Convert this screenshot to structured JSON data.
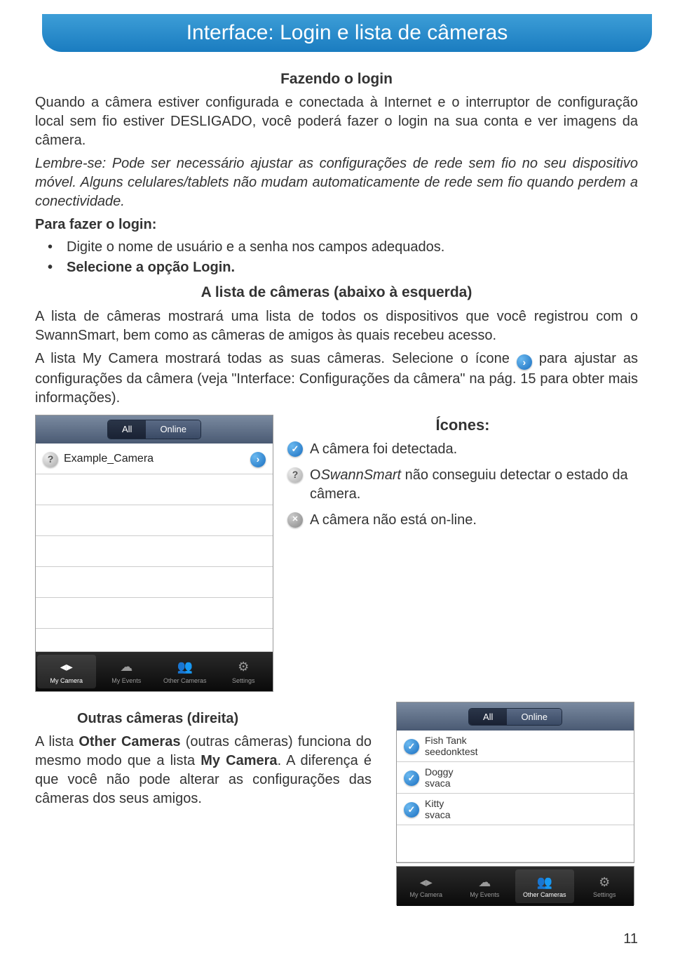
{
  "title_bar": "Interface: Login e lista de câmeras",
  "s1": {
    "heading": "Fazendo o login",
    "p1a": "Quando a câmera estiver configurada e conectada à Internet e o interruptor de configuração local sem fio estiver ",
    "p1b": "DESLIGADO",
    "p1c": ", você poderá fazer o login na sua conta e ver imagens da câmera.",
    "p2": "Lembre-se: Pode ser necessário ajustar as configurações de rede sem fio no seu dispositivo móvel. Alguns celulares/tablets não mudam automaticamente de rede sem fio quando perdem a conectividade.",
    "p3": "Para fazer o login:",
    "li1": "Digite o nome de usuário e a senha nos campos adequados.",
    "li2": "Selecione a opção Login."
  },
  "s2": {
    "heading": "A lista de câmeras (abaixo à esquerda)",
    "p1": "A lista de câmeras mostrará uma lista de todos os dispositivos que você registrou com o SwannSmart, bem como as câmeras de amigos às quais recebeu acesso.",
    "p2a": "A lista My Camera mostrará todas as suas câmeras. Selecione o ícone ",
    "p2b": " para ajustar as configurações da câmera (veja \"Interface: Configurações da câmera\" na pág. 15 para obter mais informações)."
  },
  "icons": {
    "heading": "Ícones:",
    "i1": "A câmera foi detectada.",
    "i2a": "O",
    "i2b": "SwannSmart",
    "i2c": " não conseguiu detectar o estado da câmera.",
    "i3": "A câmera não está on-line."
  },
  "mock1": {
    "seg_all": "All",
    "seg_online": "Online",
    "cam": "Example_Camera",
    "tab1": "My Camera",
    "tab2": "My Events",
    "tab3": "Other Cameras",
    "tab4": "Settings"
  },
  "mock2": {
    "seg_all": "All",
    "seg_online": "Online",
    "r1n": "Fish Tank",
    "r1o": "seedonktest",
    "r2n": "Doggy",
    "r2o": "svaca",
    "r3n": "Kitty",
    "r3o": "svaca",
    "tab1": "My Camera",
    "tab2": "My Events",
    "tab3": "Other Cameras",
    "tab4": "Settings"
  },
  "s3": {
    "heading": "Outras câmeras (direita)",
    "p1a": "A lista ",
    "p1b": "Other Cameras",
    "p1c": " (outras câmeras) funciona do mesmo modo que a lista ",
    "p1d": "My Camera",
    "p1e": ". A diferença é que você não pode alterar as configurações das câmeras dos seus amigos."
  },
  "page_number": "11"
}
